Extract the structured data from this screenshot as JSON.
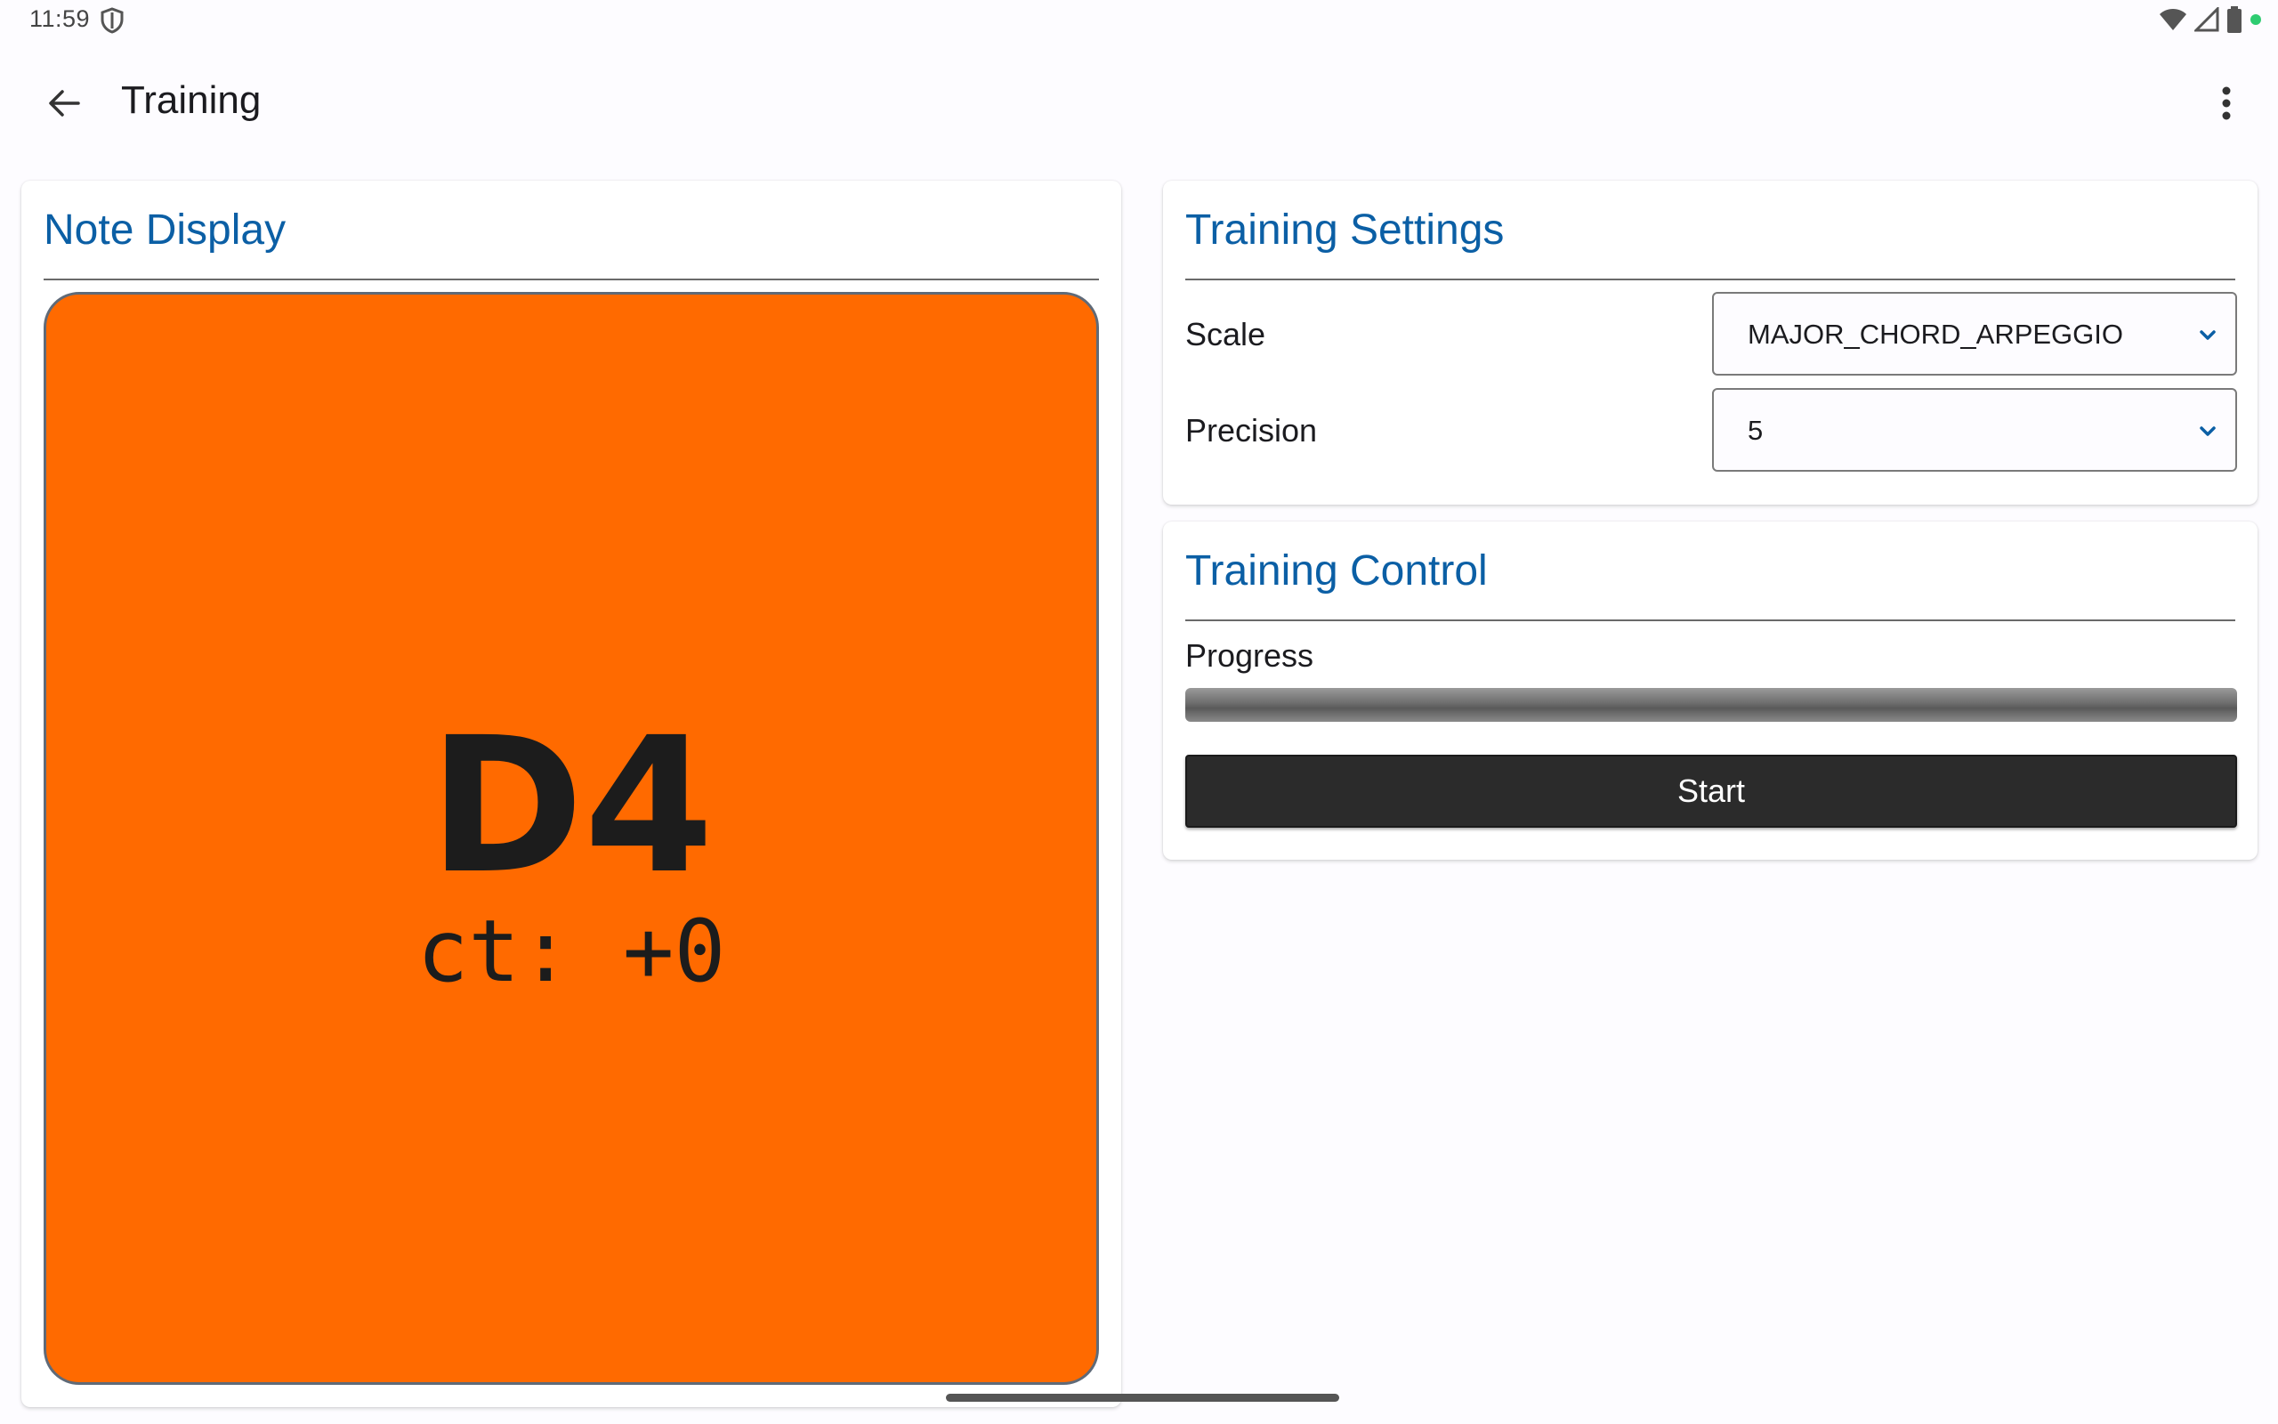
{
  "status_bar": {
    "time": "11:59",
    "icons": [
      "shield-icon",
      "wifi-icon",
      "cell-signal-icon",
      "battery-icon",
      "notification-dot-icon"
    ]
  },
  "app_bar": {
    "title": "Training",
    "back_icon": "arrow-left-icon",
    "overflow_icon": "more-vert-icon"
  },
  "note_display": {
    "title": "Note Display",
    "note": "D4",
    "cents": "ct: +0",
    "color": "#ff6a00"
  },
  "training_settings": {
    "title": "Training Settings",
    "scale": {
      "label": "Scale",
      "value": "MAJOR_CHORD_ARPEGGIO"
    },
    "precision": {
      "label": "Precision",
      "value": "5"
    }
  },
  "training_control": {
    "title": "Training Control",
    "progress_label": "Progress",
    "progress_percent": 0,
    "start_label": "Start"
  },
  "colors": {
    "accent": "#0b5fa5",
    "button": "#2b2b2b",
    "status_dot": "#2ecc71"
  }
}
